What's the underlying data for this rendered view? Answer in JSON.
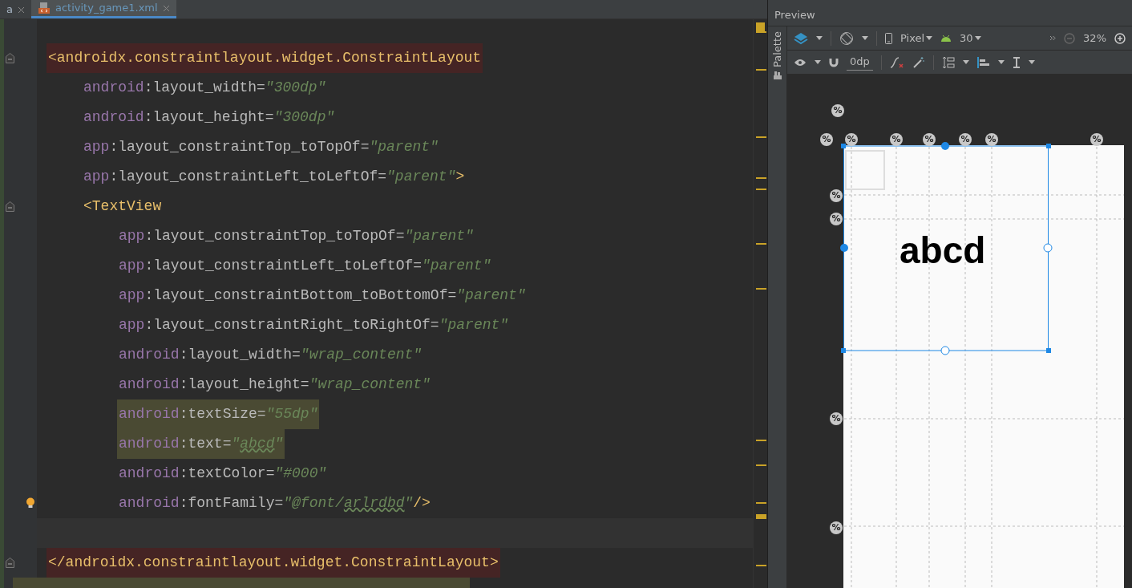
{
  "tabs": [
    {
      "label": "a",
      "selected": false
    },
    {
      "label": "activity_game1.xml",
      "selected": true
    }
  ],
  "code": [
    {
      "highlighted": true,
      "parts": [
        {
          "kind": "tag",
          "text": "<androidx.constraintlayout.widget.ConstraintLayout"
        }
      ],
      "children": [
        {
          "parts": [
            {
              "kind": "ns",
              "text": "android"
            },
            {
              "kind": "punct",
              "text": ":layout_width="
            },
            {
              "kind": "value",
              "text": "\"300dp\""
            }
          ]
        },
        {
          "parts": [
            {
              "kind": "ns",
              "text": "android"
            },
            {
              "kind": "punct",
              "text": ":layout_height="
            },
            {
              "kind": "value",
              "text": "\"300dp\""
            }
          ]
        },
        {
          "parts": [
            {
              "kind": "ns",
              "text": "app"
            },
            {
              "kind": "punct",
              "text": ":layout_constraintTop_toTopOf="
            },
            {
              "kind": "value",
              "text": "\"parent\""
            }
          ]
        },
        {
          "parts": [
            {
              "kind": "ns",
              "text": "app"
            },
            {
              "kind": "punct",
              "text": ":layout_constraintLeft_toLeftOf="
            },
            {
              "kind": "value",
              "text": "\"parent\""
            },
            {
              "kind": "tag",
              "text": ">"
            }
          ]
        },
        {
          "parts": [
            {
              "kind": "tag",
              "text": "<TextView"
            }
          ],
          "children": [
            {
              "parts": [
                {
                  "kind": "ns",
                  "text": "app"
                },
                {
                  "kind": "punct",
                  "text": ":layout_constraintTop_toTopOf="
                },
                {
                  "kind": "value",
                  "text": "\"parent\""
                }
              ]
            },
            {
              "parts": [
                {
                  "kind": "ns",
                  "text": "app"
                },
                {
                  "kind": "punct",
                  "text": ":layout_constraintLeft_toLeftOf="
                },
                {
                  "kind": "value",
                  "text": "\"parent\""
                }
              ]
            },
            {
              "parts": [
                {
                  "kind": "ns",
                  "text": "app"
                },
                {
                  "kind": "punct",
                  "text": ":layout_constraintBottom_toBottomOf="
                },
                {
                  "kind": "value",
                  "text": "\"parent\""
                }
              ]
            },
            {
              "parts": [
                {
                  "kind": "ns",
                  "text": "app"
                },
                {
                  "kind": "punct",
                  "text": ":layout_constraintRight_toRightOf="
                },
                {
                  "kind": "value",
                  "text": "\"parent\""
                }
              ]
            },
            {
              "parts": [
                {
                  "kind": "ns",
                  "text": "android"
                },
                {
                  "kind": "punct",
                  "text": ":layout_width="
                },
                {
                  "kind": "value",
                  "text": "\"wrap_content\""
                }
              ]
            },
            {
              "parts": [
                {
                  "kind": "ns",
                  "text": "android"
                },
                {
                  "kind": "punct",
                  "text": ":layout_height="
                },
                {
                  "kind": "value",
                  "text": "\"wrap_content\""
                }
              ]
            },
            {
              "search_match": true,
              "parts": [
                {
                  "kind": "ns",
                  "text": "android"
                },
                {
                  "kind": "punct",
                  "text": ":textSize="
                },
                {
                  "kind": "value",
                  "text": "\"55dp\""
                }
              ]
            },
            {
              "search_match": true,
              "parts": [
                {
                  "kind": "ns",
                  "text": "android"
                },
                {
                  "kind": "punct",
                  "text": ":text="
                },
                {
                  "kind": "value",
                  "text": "\""
                },
                {
                  "kind": "typo",
                  "text": "abcd"
                },
                {
                  "kind": "value",
                  "text": "\""
                }
              ]
            },
            {
              "parts": [
                {
                  "kind": "ns",
                  "text": "android"
                },
                {
                  "kind": "punct",
                  "text": ":textColor="
                },
                {
                  "kind": "value",
                  "text": "\"#000\""
                }
              ]
            },
            {
              "bulb": true,
              "parts": [
                {
                  "kind": "ns",
                  "text": "android"
                },
                {
                  "kind": "punct",
                  "text": ":fontFamily="
                },
                {
                  "kind": "value",
                  "text": "\"@font/"
                },
                {
                  "kind": "typo",
                  "text": "arlrdbd"
                },
                {
                  "kind": "value",
                  "text": "\""
                },
                {
                  "kind": "tag",
                  "text": "/>"
                }
              ]
            }
          ]
        }
      ]
    },
    {
      "current": true
    },
    {
      "highlighted": true,
      "parts": [
        {
          "kind": "tag",
          "text": "</androidx.constraintlayout.widget.ConstraintLayout>"
        }
      ]
    }
  ],
  "preview": {
    "title": "Preview",
    "side_tab": "Palette",
    "device": "Pixel",
    "api": "30",
    "zoom": "32%",
    "margin": "0dp",
    "text_view": "abcd",
    "guideline_badges": [
      "%",
      "%",
      "%",
      "%",
      "%",
      "%",
      "%",
      "%",
      "%",
      "%",
      "%",
      "%"
    ]
  }
}
